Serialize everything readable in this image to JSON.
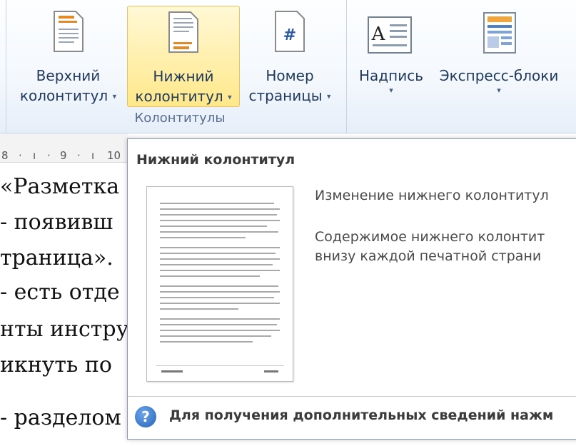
{
  "ribbon": {
    "header_button": {
      "line1": "Верхний",
      "line2": "колонтитул",
      "icon": "page-header-icon"
    },
    "footer_button": {
      "line1": "Нижний",
      "line2": "колонтитул",
      "icon": "page-footer-icon"
    },
    "page_number_button": {
      "line1": "Номер",
      "line2": "страницы",
      "icon": "page-number-icon"
    },
    "textbox_button": {
      "label": "Надпись",
      "icon": "textbox-icon"
    },
    "quickparts_button": {
      "label": "Экспресс-блоки",
      "icon": "quick-parts-icon"
    },
    "group_label": "Колонтитулы",
    "dropdown_arrow": "▾"
  },
  "ruler": {
    "marks": [
      "8",
      "9",
      "10"
    ]
  },
  "document": {
    "lines": [
      "«Разметка",
      "- появивш",
      "траница».",
      "- есть отде",
      "нты инстру",
      "икнуть по",
      "- разделом"
    ]
  },
  "popup": {
    "title": "Нижний колонтитул",
    "description_line1": "Изменение нижнего колонтитул",
    "description_line2": "Содержимое нижнего колонтит",
    "description_line3": "внизу каждой печатной страни",
    "help_icon_glyph": "?",
    "help_text": "Для получения дополнительных сведений нажм"
  },
  "colors": {
    "ribbon_text": "#1e395b",
    "active_button": "#ffe88a",
    "help_icon": "#2362b8"
  }
}
